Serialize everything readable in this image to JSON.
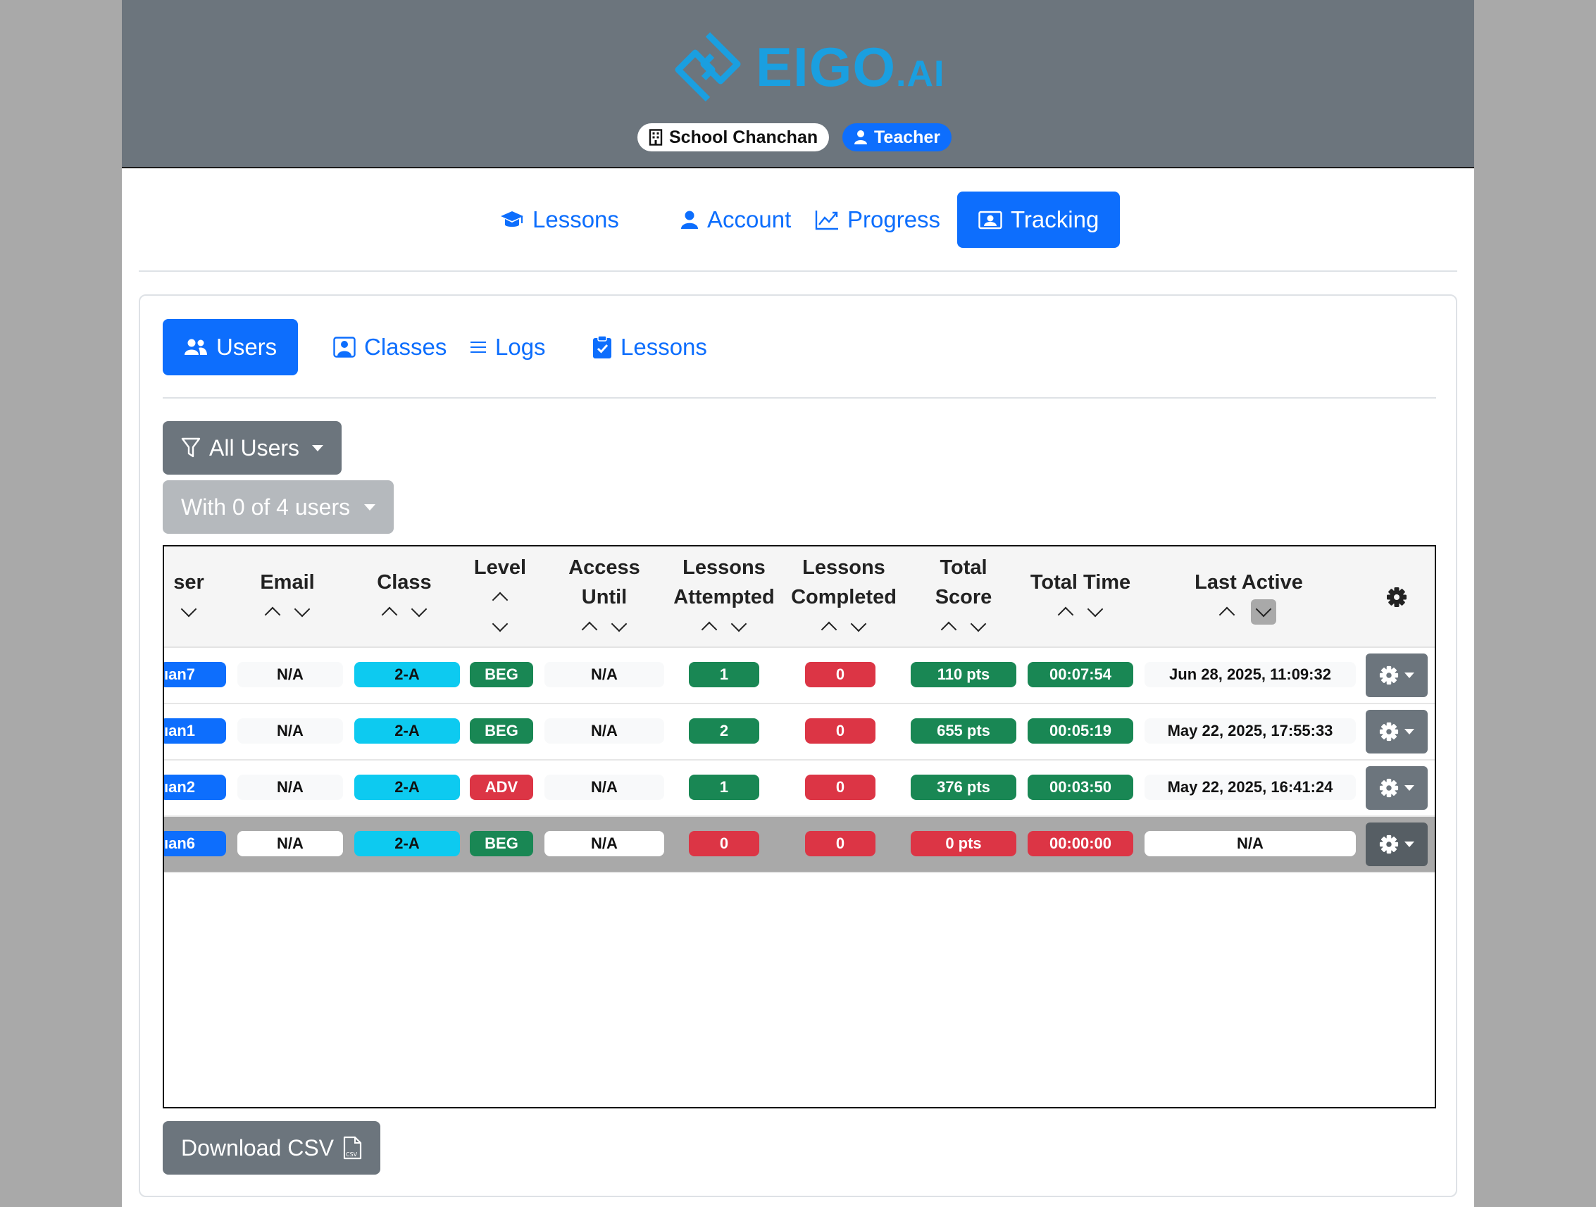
{
  "header": {
    "logo_text": "EIGO",
    "logo_suffix": ".AI",
    "school": "School Chanchan",
    "role": "Teacher"
  },
  "main_nav": [
    {
      "label": "Lessons",
      "icon": "graduation-cap-icon",
      "active": false
    },
    {
      "label": "Account",
      "icon": "person-icon",
      "active": false
    },
    {
      "label": "Progress",
      "icon": "chart-line-icon",
      "active": false
    },
    {
      "label": "Tracking",
      "icon": "person-badge-icon",
      "active": true
    }
  ],
  "sub_nav": [
    {
      "label": "Users",
      "icon": "people-icon",
      "active": true
    },
    {
      "label": "Classes",
      "icon": "person-square-icon",
      "active": false
    },
    {
      "label": "Logs",
      "icon": "list-icon",
      "active": false
    },
    {
      "label": "Lessons",
      "icon": "clipboard-check-icon",
      "active": false
    }
  ],
  "filter": {
    "label": "All Users"
  },
  "selection": {
    "label": "With 0 of 4 users"
  },
  "table": {
    "columns": {
      "user": "ser",
      "email": "Email",
      "class": "Class",
      "level": "Level",
      "access_1": "Access",
      "access_2": "Until",
      "attempted_1": "Lessons",
      "attempted_2": "Attempted",
      "completed_1": "Lessons",
      "completed_2": "Completed",
      "score_1": "Total",
      "score_2": "Score",
      "time": "Total Time",
      "last_active": "Last Active"
    },
    "rows": [
      {
        "user": "ıan7",
        "email": "N/A",
        "class": "2-A",
        "level": "BEG",
        "access": "N/A",
        "attempted": "1",
        "completed": "0",
        "score": "110 pts",
        "time": "00:07:54",
        "last_active": "Jun 28, 2025, 11:09:32"
      },
      {
        "user": "ıan1",
        "email": "N/A",
        "class": "2-A",
        "level": "BEG",
        "access": "N/A",
        "attempted": "2",
        "completed": "0",
        "score": "655 pts",
        "time": "00:05:19",
        "last_active": "May 22, 2025, 17:55:33"
      },
      {
        "user": "ıan2",
        "email": "N/A",
        "class": "2-A",
        "level": "ADV",
        "access": "N/A",
        "attempted": "1",
        "completed": "0",
        "score": "376 pts",
        "time": "00:03:50",
        "last_active": "May 22, 2025, 16:41:24"
      },
      {
        "user": "ıan6",
        "email": "N/A",
        "class": "2-A",
        "level": "BEG",
        "access": "N/A",
        "attempted": "0",
        "completed": "0",
        "score": "0 pts",
        "time": "00:00:00",
        "last_active": "N/A"
      }
    ]
  },
  "download": {
    "label": "Download CSV",
    "icon": "file-csv-icon"
  },
  "colors": {
    "primary": "#0d6efd",
    "secondary": "#6c757d",
    "success": "#198754",
    "danger": "#dc3545",
    "info": "#0dcaf0",
    "logo": "#1a9fe0"
  }
}
